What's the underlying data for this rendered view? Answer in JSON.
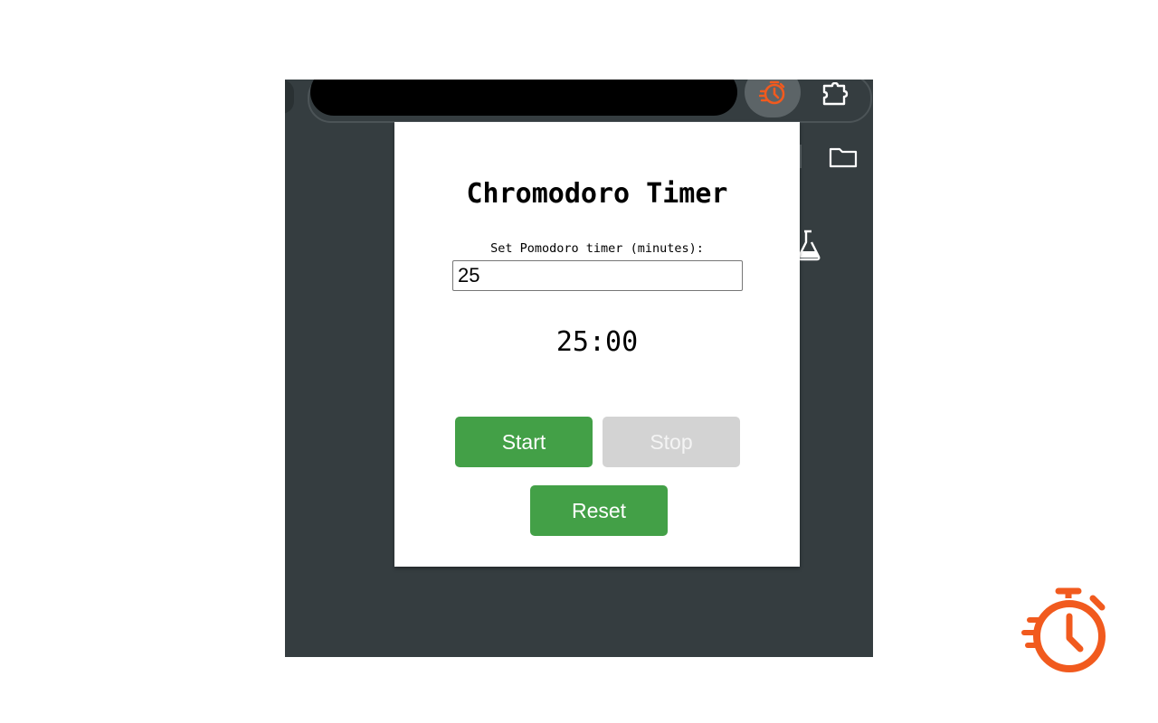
{
  "popup": {
    "title": "Chromodoro Timer",
    "minutes_label": "Set Pomodoro timer (minutes):",
    "minutes_value": "25",
    "countdown": "25:00",
    "buttons": {
      "start": "Start",
      "stop": "Stop",
      "reset": "Reset"
    }
  },
  "toolbar": {
    "icons": [
      "timer-extension-icon",
      "extensions-puzzle-icon",
      "folder-icon",
      "flask-icon"
    ]
  },
  "colors": {
    "accent_orange": "#f15a1e",
    "button_green": "#43a047",
    "button_disabled": "#d3d3d3",
    "browser_bg": "#353d40"
  }
}
